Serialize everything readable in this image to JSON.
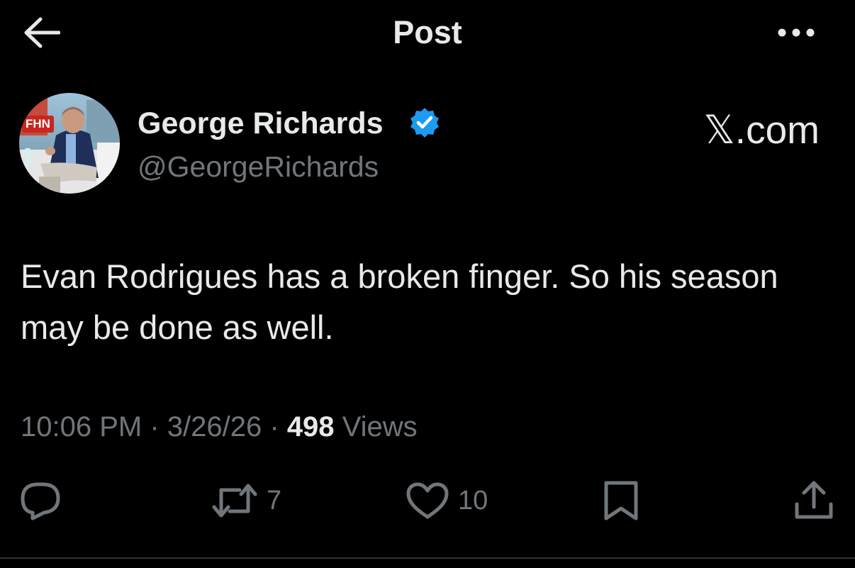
{
  "header": {
    "title": "Post"
  },
  "author": {
    "name": "George Richards",
    "handle": "@GeorgeRichards",
    "avatar_badge": "FHN"
  },
  "watermark": "𝕏.com",
  "post": {
    "text": "Evan Rodrigues has a broken finger. So his season may be done as well."
  },
  "meta": {
    "time": "10:06 PM",
    "date": "3/26/26",
    "views_count": "498",
    "views_label": "Views"
  },
  "actions": {
    "reply_count": "",
    "repost_count": "7",
    "like_count": "10"
  },
  "colors": {
    "background": "#000000",
    "text": "#e7e9ea",
    "secondary": "#71767b",
    "verified": "#1d9bf0"
  },
  "icons": [
    "back-arrow-icon",
    "more-icon",
    "verified-badge-icon",
    "reply-icon",
    "repost-icon",
    "like-icon",
    "bookmark-icon",
    "share-icon"
  ]
}
